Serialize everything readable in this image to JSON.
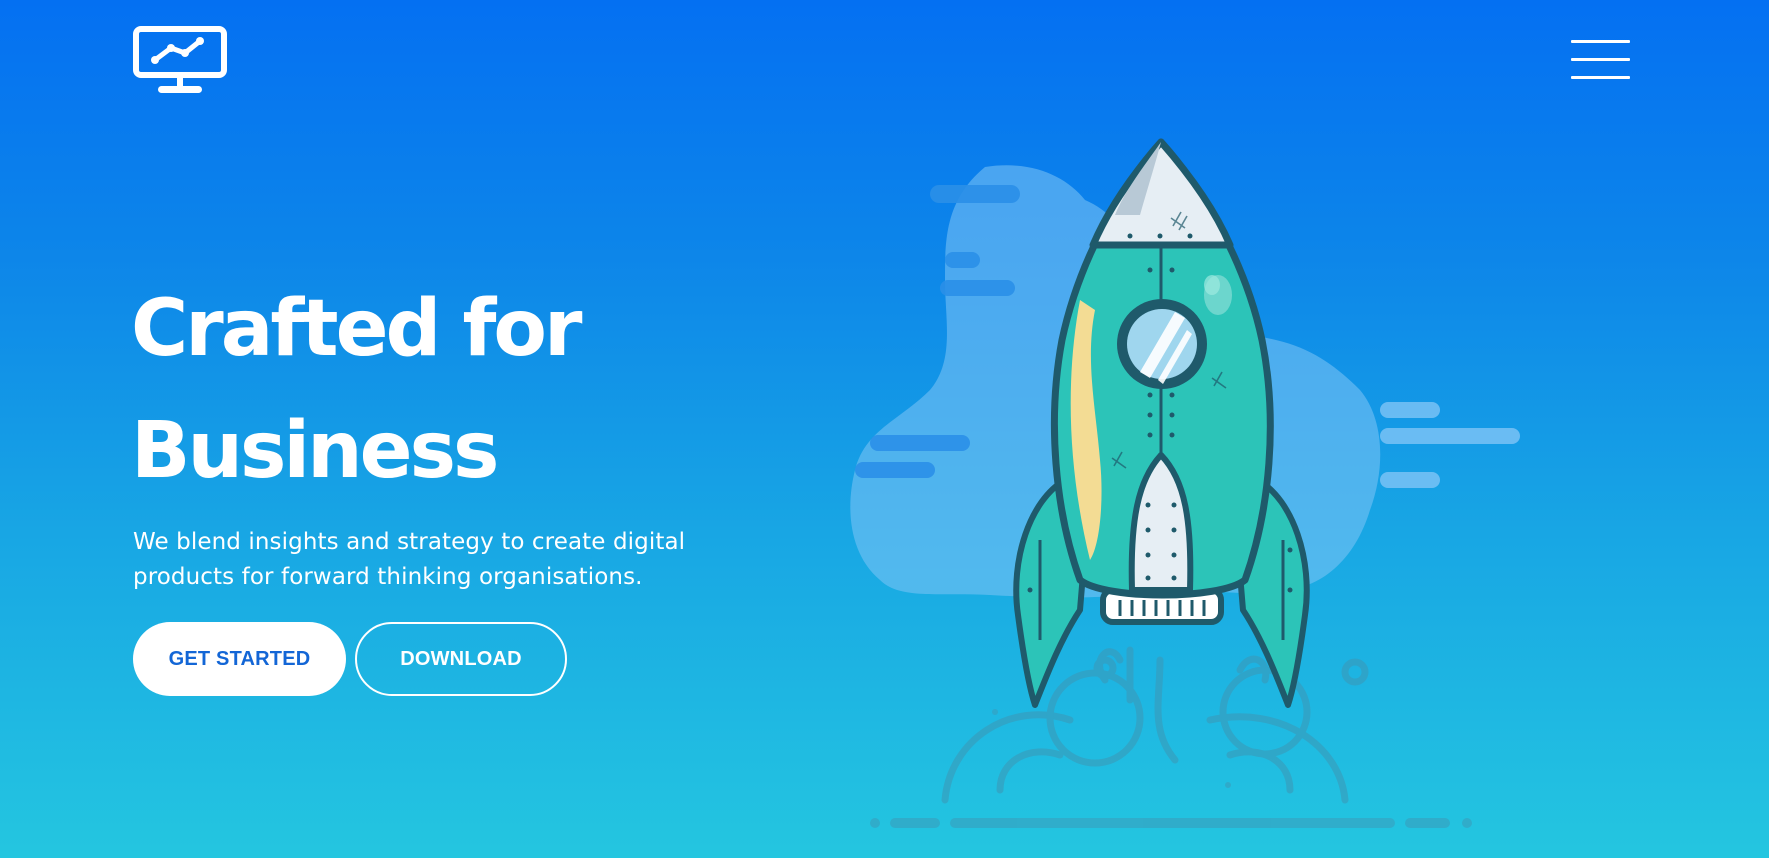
{
  "header": {
    "logo_icon": "monitor-chart-icon",
    "menu_icon": "hamburger-menu-icon"
  },
  "hero": {
    "title_line1": "Crafted for",
    "title_line2": "Business",
    "description": "We blend insights and strategy to create digital products for forward thinking organisations.",
    "primary_button": "GET STARTED",
    "secondary_button": "DOWNLOAD"
  },
  "illustration": {
    "icon": "rocket-launch-icon"
  },
  "colors": {
    "gradient_top": "#0470f2",
    "gradient_bottom": "#24c6e0",
    "primary_button_text": "#1366d6",
    "rocket_body": "#2cc4b8",
    "rocket_outline": "#1f5a6b"
  }
}
